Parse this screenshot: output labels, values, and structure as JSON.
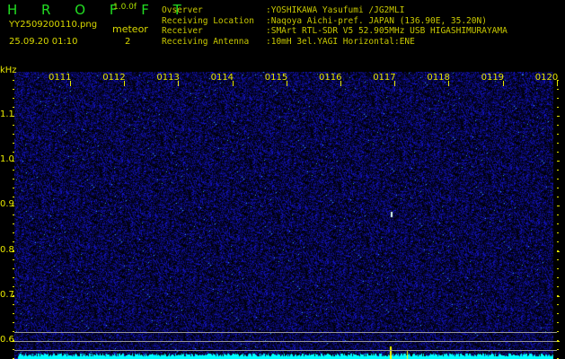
{
  "header": {
    "title": "H R O F F T",
    "version": "1.0.0f",
    "filename": "YY2509200110.png",
    "datetime": "25.09.20 01:10",
    "count_label": "meteor",
    "count_value": "2"
  },
  "info": [
    {
      "key": "Ovserver",
      "value": ":YOSHIKAWA Yasufumi /JG2MLI"
    },
    {
      "key": "Receiving Location",
      "value": ":Naqoya Aichi-pref. JAPAN (136.90E, 35.20N)"
    },
    {
      "key": "Receiver",
      "value": ":SMArt RTL-SDR V5 52.905MHz USB HIGASHIMURAYAMA"
    },
    {
      "key": "Receiving Antenna",
      "value": ":10mH 3el.YAGI Horizontal:ENE"
    }
  ],
  "axis": {
    "unit": "kHz",
    "y_labels": [
      "1.1",
      "1.0",
      "0.9",
      "0.8",
      "0.7",
      "0.6"
    ],
    "time_labels": [
      "0111",
      "0112",
      "0113",
      "0114",
      "0115",
      "0116",
      "0117",
      "0118",
      "0119",
      "0120"
    ]
  },
  "colors": {
    "background": "#000000",
    "noise": "#1a1acc",
    "baseline": "#00ffff",
    "label": "#e8e800"
  }
}
